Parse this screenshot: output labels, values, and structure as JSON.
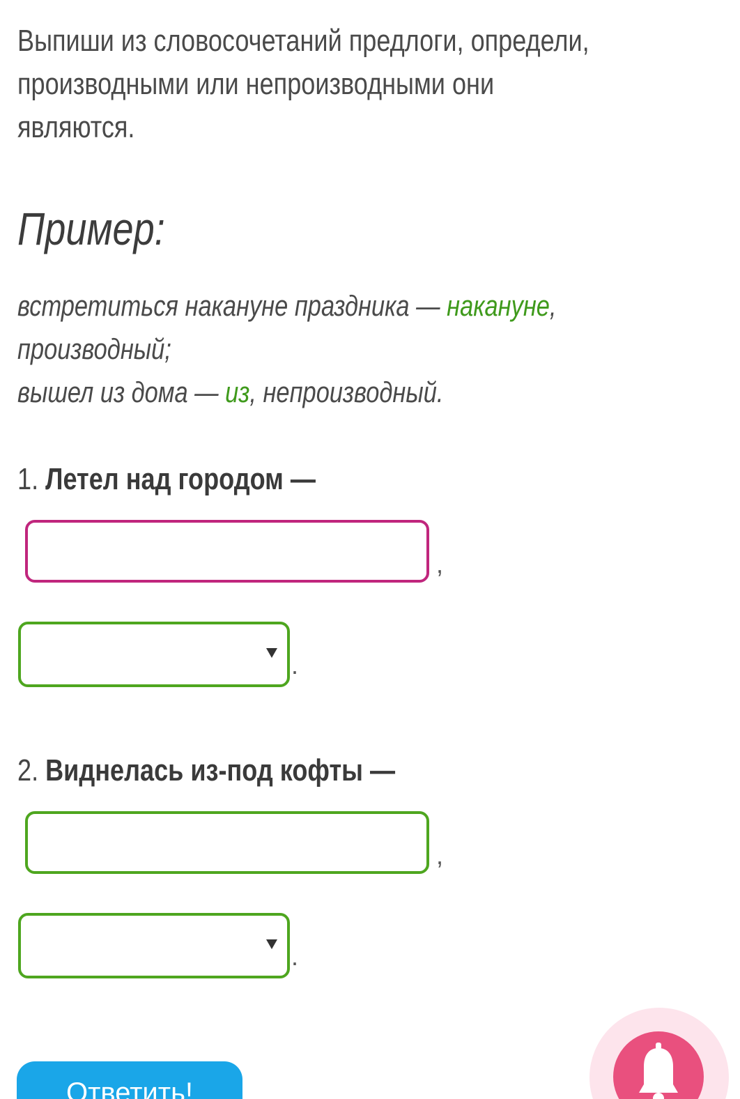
{
  "instruction": {
    "line1": "Выпиши из словосочетаний предлоги, определи,",
    "line2": "производными или непроизводными они",
    "line3": "являются."
  },
  "example": {
    "heading": "Пример:",
    "line1_prefix": "встретиться накануне праздника — ",
    "line1_answer": "накануне",
    "line1_suffix": ",",
    "line2": "производный;",
    "line3_prefix": "вышел из дома — ",
    "line3_answer": "из",
    "line3_suffix": ", непроизводный."
  },
  "questions": [
    {
      "number": "1.",
      "text": "Летел над городом —",
      "answer_value": "",
      "type_value": "",
      "comma": ",",
      "period": "."
    },
    {
      "number": "2.",
      "text": "Виднелась из-под кофты —",
      "answer_value": "",
      "type_value": "",
      "comma": ",",
      "period": "."
    }
  ],
  "submit": {
    "label": "Ответить!"
  },
  "colors": {
    "accent_green": "#4ea61f",
    "active_magenta": "#c0267d",
    "button_blue": "#1aa6e8",
    "bell_pink": "#e9507e"
  },
  "icons": {
    "select_arrow": "chevron-down-icon",
    "notification": "bell-icon"
  }
}
